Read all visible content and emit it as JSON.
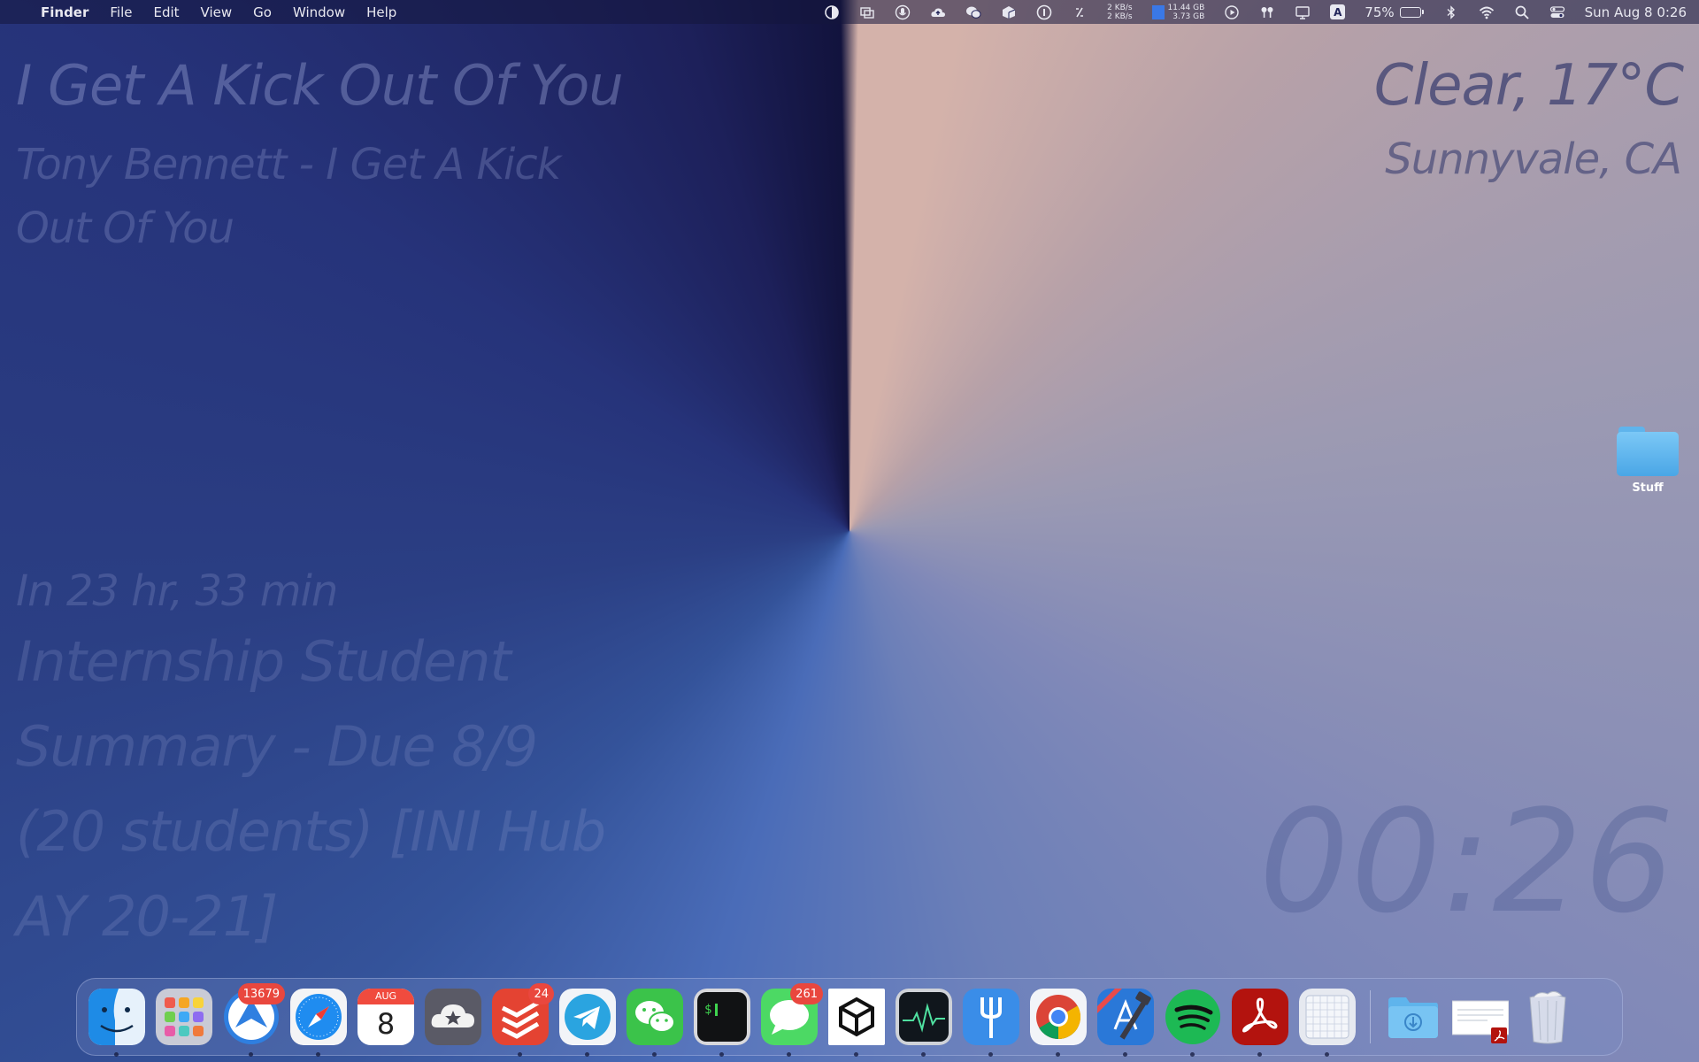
{
  "menubar": {
    "apple_glyph": "",
    "app_name": "Finder",
    "menus": [
      "File",
      "Edit",
      "View",
      "Go",
      "Window",
      "Help"
    ],
    "status_icons": [
      "contrast-icon",
      "window-switch-icon",
      "microphone-icon",
      "cloud-upload-icon",
      "wechat-icon",
      "box-icon",
      "info-icon",
      "stats-icon"
    ],
    "net_up": "2 KB/s",
    "net_down": "2 KB/s",
    "mem_used": "11.44 GB",
    "mem_free": "3.73 GB",
    "input_source": "A",
    "battery_percent": "75%",
    "battery_level": 0.75,
    "datetime": "Sun Aug 8  0:26"
  },
  "widgets": {
    "song_title": "I Get A Kick Out Of You",
    "song_artist": "Tony Bennett - I Get A Kick Out Of You",
    "weather": "Clear, 17°C",
    "location": "Sunnyvale, CA",
    "event_time": "In 23 hr, 33 min",
    "event_title": "Internship Student Summary - Due 8/9 (20 students) [INI Hub AY 20-21]",
    "clock": "00:26"
  },
  "desktop": {
    "folder_label": "Stuff"
  },
  "dock": {
    "items": [
      {
        "name": "finder",
        "running": true
      },
      {
        "name": "launchpad",
        "running": false
      },
      {
        "name": "spark-mail",
        "running": true,
        "badge": "13679"
      },
      {
        "name": "safari",
        "running": true
      },
      {
        "name": "calendar",
        "running": false,
        "month": "AUG",
        "day": "8"
      },
      {
        "name": "reeder",
        "running": false
      },
      {
        "name": "todoist",
        "running": true,
        "badge": "24"
      },
      {
        "name": "telegram",
        "running": true
      },
      {
        "name": "wechat",
        "running": true
      },
      {
        "name": "terminal",
        "running": true
      },
      {
        "name": "messages",
        "running": true,
        "badge": "261"
      },
      {
        "name": "unity",
        "running": true
      },
      {
        "name": "activity-monitor",
        "running": true
      },
      {
        "name": "fork",
        "running": true
      },
      {
        "name": "chrome",
        "running": true
      },
      {
        "name": "xcode-beta",
        "running": true
      },
      {
        "name": "spotify",
        "running": true
      },
      {
        "name": "acrobat",
        "running": true
      },
      {
        "name": "preview-grid",
        "running": true
      }
    ],
    "stack_items": [
      "downloads-folder",
      "pdf-document",
      "trash"
    ]
  },
  "colors": {
    "accent_blue": "#3a78e6",
    "badge_red": "#e9473e"
  }
}
